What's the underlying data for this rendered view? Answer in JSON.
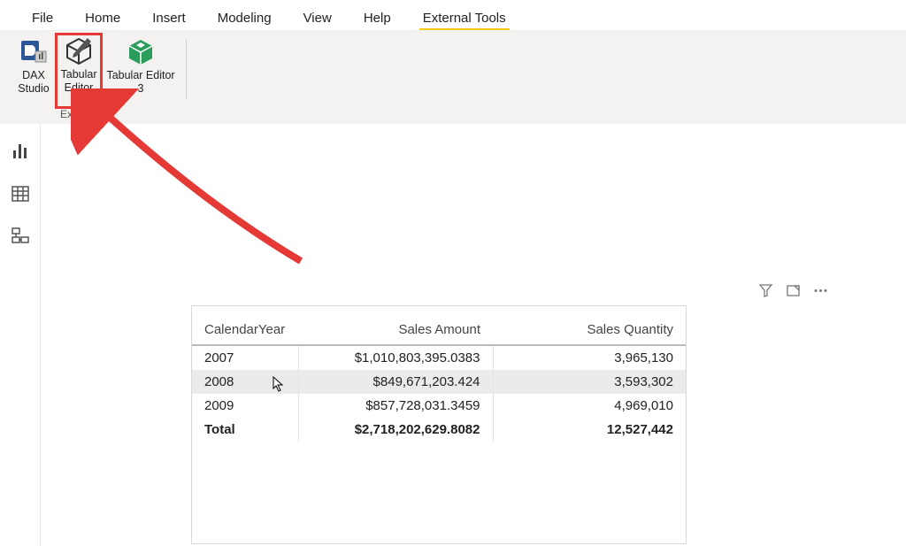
{
  "ribbon": {
    "tabs": [
      "File",
      "Home",
      "Insert",
      "Modeling",
      "View",
      "Help",
      "External Tools"
    ],
    "active_index": 6,
    "group_label": "External",
    "buttons": {
      "dax_studio": {
        "line1": "DAX",
        "line2": "Studio"
      },
      "tabular_editor": {
        "line1": "Tabular",
        "line2": "Editor"
      },
      "tabular_editor_3": {
        "line1": "Tabular Editor",
        "line2": "3"
      }
    }
  },
  "left_rail": {
    "items": [
      "report-view",
      "data-view",
      "model-view"
    ]
  },
  "table": {
    "columns": [
      "CalendarYear",
      "Sales Amount",
      "Sales Quantity"
    ],
    "rows": [
      {
        "year": "2007",
        "amount": "$1,010,803,395.0383",
        "qty": "3,965,130",
        "selected": false
      },
      {
        "year": "2008",
        "amount": "$849,671,203.424",
        "qty": "3,593,302",
        "selected": true
      },
      {
        "year": "2009",
        "amount": "$857,728,031.3459",
        "qty": "4,969,010",
        "selected": false
      }
    ],
    "total": {
      "label": "Total",
      "amount": "$2,718,202,629.8082",
      "qty": "12,527,442"
    }
  },
  "visual_header": {
    "filter": "filter",
    "focus": "focus-mode",
    "more": "more-options"
  },
  "chart_data": {
    "type": "table",
    "columns": [
      "CalendarYear",
      "Sales Amount",
      "Sales Quantity"
    ],
    "rows": [
      [
        "2007",
        1010803395.0383,
        3965130
      ],
      [
        "2008",
        849671203.424,
        3593302
      ],
      [
        "2009",
        857728031.3459,
        4969010
      ]
    ],
    "total": [
      "Total",
      2718202629.8082,
      12527442
    ]
  }
}
